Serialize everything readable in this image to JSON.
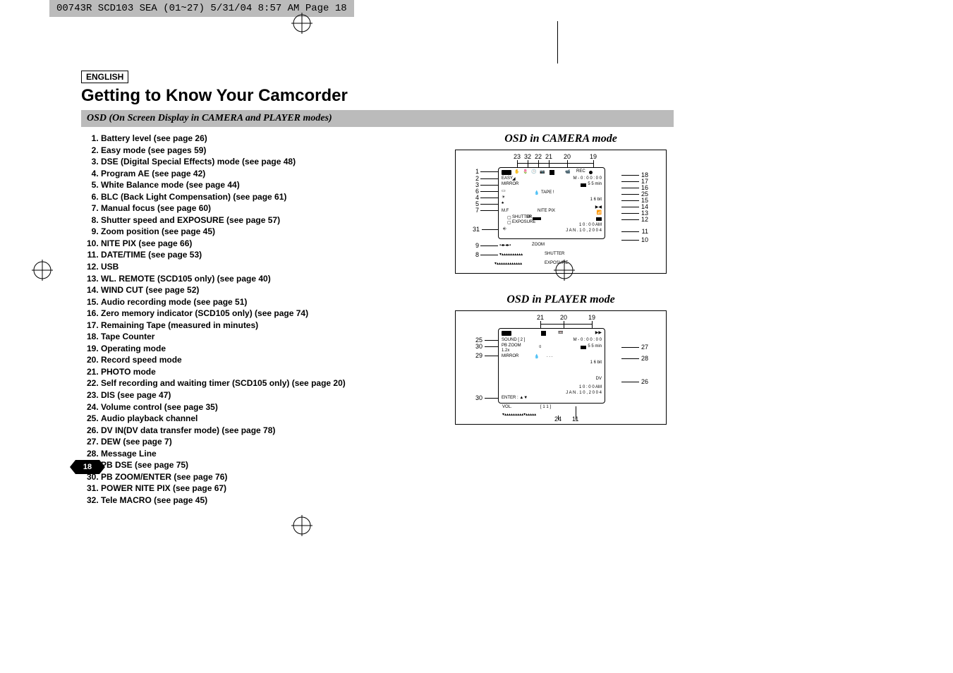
{
  "header_strip": "00743R SCD103 SEA (01~27)  5/31/04  8:57 AM  Page 18",
  "lang": "ENGLISH",
  "title": "Getting to Know Your Camcorder",
  "section_bar": "OSD (On Screen Display in CAMERA and PLAYER modes)",
  "osd_list": [
    "Battery level (see page 26)",
    "Easy mode (see pages 59)",
    "DSE (Digital Special Effects) mode (see page 48)",
    "Program AE (see page 42)",
    "White Balance mode (see page 44)",
    "BLC (Back Light Compensation) (see page 61)",
    "Manual focus (see page 60)",
    "Shutter speed and EXPOSURE (see page 57)",
    "Zoom position (see page 45)",
    "NITE PIX (see page 66)",
    "DATE/TIME (see page 53)",
    "USB",
    "WL. REMOTE (SCD105 only) (see page 40)",
    "WIND CUT (see page 52)",
    "Audio recording mode (see page 51)",
    "Zero memory indicator (SCD105 only) (see page 74)",
    "Remaining Tape (measured in minutes)",
    "Tape Counter",
    "Operating mode",
    "Record speed mode",
    "PHOTO mode",
    "Self recording and waiting timer (SCD105 only) (see page 20)",
    "DIS (see page 47)",
    "Volume control (see page 35)",
    "Audio playback channel",
    "DV IN(DV data transfer mode) (see page 78)",
    "DEW (see page 7)",
    "Message Line",
    "PB DSE (see page 75)",
    "PB ZOOM/ENTER (see page 76)",
    "POWER NITE PIX (see page 67)",
    "Tele MACRO (see page 45)"
  ],
  "fig1": {
    "title": "OSD in CAMERA mode",
    "top_nums": [
      "23",
      "32",
      "22",
      "21",
      "20",
      "19"
    ],
    "left_nums": [
      "1",
      "2",
      "3",
      "6",
      "4",
      "5",
      "7",
      "31",
      "9",
      "8"
    ],
    "right_nums": [
      "18",
      "17",
      "16",
      "25",
      "15",
      "14",
      "13",
      "12",
      "11",
      "10"
    ],
    "screen": {
      "rec": "REC",
      "easy": "EASY",
      "mirror": "MIRROR",
      "tape": "TAPE !",
      "mf": "M.F",
      "nitepix": "NITE PIX",
      "shutter_lbl": "SHUTTER",
      "exposure_lbl": "EXPOSURE",
      "counter": "M - 0 : 0 0 : 0 0",
      "remain": "5 5 min",
      "16bit": "1 6 bit",
      "time": "1 0 : 0 0 AM",
      "date": "J A N . 1 0 , 2 0 0 4",
      "zoom": "ZOOM",
      "shutter_bot": "SHUTTER",
      "exposure_bot": "EXPOSURE"
    }
  },
  "fig2": {
    "title": "OSD in PLAYER mode",
    "top_nums": [
      "21",
      "20",
      "19"
    ],
    "left_nums": [
      "25",
      "30",
      "29",
      "30"
    ],
    "right_nums": [
      "27",
      "28",
      "26"
    ],
    "bottom_nums": [
      "24",
      "11"
    ],
    "screen": {
      "sound": "SOUND [ 2 ]",
      "pbzoom": "PB ZOOM",
      "scale": "1.2x",
      "mirror": "MIRROR",
      "sp": "SP",
      "counter": "M - 0 : 0 0 : 0 0",
      "remain": "5 5 min",
      "16bit": "1 6 bit",
      "dvin": "DV",
      "time": "1 0 : 0 0 AM",
      "date": "J A N . 1 0 , 2 0 0 4",
      "enter": "ENTER : ▲▼",
      "vol": "VOL.",
      "vol_n": "[ 1 1 ]"
    }
  },
  "page_number": "18"
}
